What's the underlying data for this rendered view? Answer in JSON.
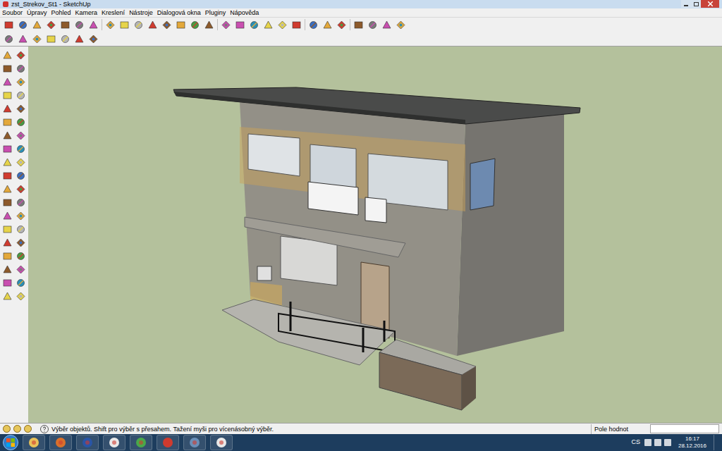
{
  "window": {
    "title": "zst_Strekov_St1 - SketchUp"
  },
  "menu": {
    "items": [
      "Soubor",
      "Úpravy",
      "Pohled",
      "Kamera",
      "Kreslení",
      "Nástroje",
      "Dialogová okna",
      "Pluginy",
      "Nápověda"
    ]
  },
  "status_bar": {
    "hint": "Výběr objektů. Shift pro výběr s přesahem. Tažení myši pro vícenásobný výběr.",
    "value_label": "Pole hodnot"
  },
  "taskbar": {
    "language": "CS",
    "time": "16:17",
    "date": "28.12.2016"
  }
}
